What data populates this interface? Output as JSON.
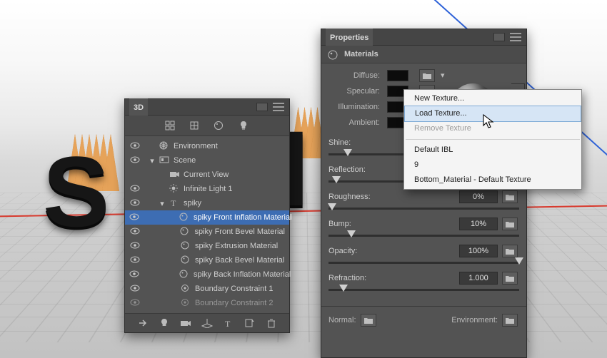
{
  "threeD": {
    "title": "3D",
    "items": [
      {
        "label": "Environment",
        "depth": 0,
        "eye": true,
        "twisty": "",
        "icon": "env"
      },
      {
        "label": "Scene",
        "depth": 0,
        "eye": true,
        "twisty": "▾",
        "icon": "scene"
      },
      {
        "label": "Current View",
        "depth": 1,
        "eye": false,
        "twisty": "",
        "icon": "camera"
      },
      {
        "label": "Infinite Light 1",
        "depth": 1,
        "eye": true,
        "twisty": "",
        "icon": "light"
      },
      {
        "label": "spiky",
        "depth": 1,
        "eye": true,
        "twisty": "▾",
        "icon": "mesh"
      },
      {
        "label": "spiky Front Inflation Material",
        "depth": 2,
        "eye": true,
        "twisty": "",
        "icon": "material",
        "selected": true
      },
      {
        "label": "spiky Front Bevel Material",
        "depth": 2,
        "eye": true,
        "twisty": "",
        "icon": "material"
      },
      {
        "label": "spiky Extrusion Material",
        "depth": 2,
        "eye": true,
        "twisty": "",
        "icon": "material"
      },
      {
        "label": "spiky Back Bevel Material",
        "depth": 2,
        "eye": true,
        "twisty": "",
        "icon": "material"
      },
      {
        "label": "spiky Back Inflation Material",
        "depth": 2,
        "eye": true,
        "twisty": "",
        "icon": "material"
      },
      {
        "label": "Boundary Constraint 1",
        "depth": 2,
        "eye": true,
        "twisty": "",
        "icon": "constraint"
      },
      {
        "label": "Boundary Constraint 2",
        "depth": 2,
        "eye": true,
        "twisty": "",
        "icon": "constraint",
        "dim": true
      }
    ]
  },
  "props": {
    "title": "Properties",
    "section": "Materials",
    "labels": {
      "diffuse": "Diffuse:",
      "specular": "Specular:",
      "illumination": "Illumination:",
      "ambient": "Ambient:",
      "shine": "Shine:",
      "reflection": "Reflection:",
      "roughness": "Roughness:",
      "bump": "Bump:",
      "opacity": "Opacity:",
      "refraction": "Refraction:",
      "normal": "Normal:",
      "environment": "Environment:"
    },
    "values": {
      "roughness": "0%",
      "bump": "10%",
      "opacity": "100%",
      "refraction": "1.000"
    },
    "thumbs": {
      "shine": 10,
      "reflection": 4,
      "roughness": 2,
      "bump": 12,
      "opacity": 100,
      "refraction": 8
    }
  },
  "menu": {
    "new": "New Texture...",
    "load": "Load Texture...",
    "remove": "Remove Texture",
    "defaultIBL": "Default IBL",
    "nine": "9",
    "bottom": "Bottom_Material - Default Texture"
  }
}
